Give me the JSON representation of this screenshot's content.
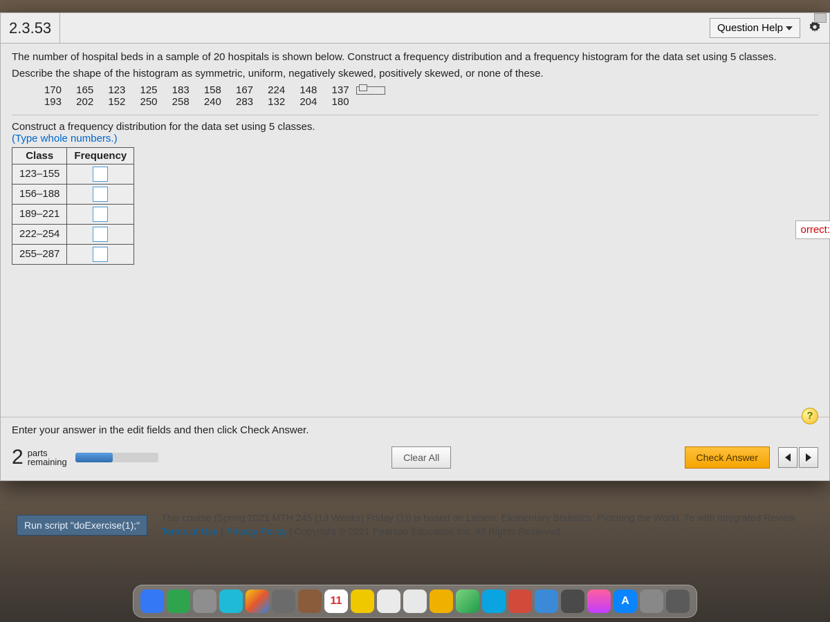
{
  "header": {
    "question_number": "2.3.53",
    "help_label": "Question Help"
  },
  "prompt": {
    "line1": "The number of hospital beds in a sample of 20 hospitals is shown below. Construct a frequency distribution and a frequency histogram for the data set using 5 classes.",
    "line2": "Describe the shape of the histogram as symmetric, uniform, negatively skewed, positively skewed, or none of these.",
    "data_row1": [
      "170",
      "165",
      "123",
      "125",
      "183",
      "158",
      "167",
      "224",
      "148",
      "137"
    ],
    "data_row2": [
      "193",
      "202",
      "152",
      "250",
      "258",
      "240",
      "283",
      "132",
      "204",
      "180"
    ]
  },
  "section2": {
    "instruction": "Construct a frequency distribution for the data set using 5 classes.",
    "note": "(Type whole numbers.)",
    "col_class": "Class",
    "col_freq": "Frequency",
    "classes": [
      "123–155",
      "156–188",
      "189–221",
      "222–254",
      "255–287"
    ]
  },
  "partial_word": "orrect:",
  "footer": {
    "hint": "Enter your answer in the edit fields and then click Check Answer.",
    "parts_count": "2",
    "parts_label_top": "parts",
    "parts_label_bottom": "remaining",
    "clear_label": "Clear All",
    "check_label": "Check Answer",
    "help_q": "?"
  },
  "below": {
    "run_script": "Run script \"doExercise(1);\"",
    "course_line1": "This course (Spring 2021 MTH 245 (13 Weeks) Friday (1)) is based on Larson: Elementary Statistics: Picturing the World, 7e with Integrated Review",
    "terms": "Terms of Use",
    "privacy": "Privacy Policy",
    "copyright": "Copyright © 2021 Pearson Education Inc. All Rights Reserved."
  },
  "dock": {
    "calendar_day": "11"
  }
}
